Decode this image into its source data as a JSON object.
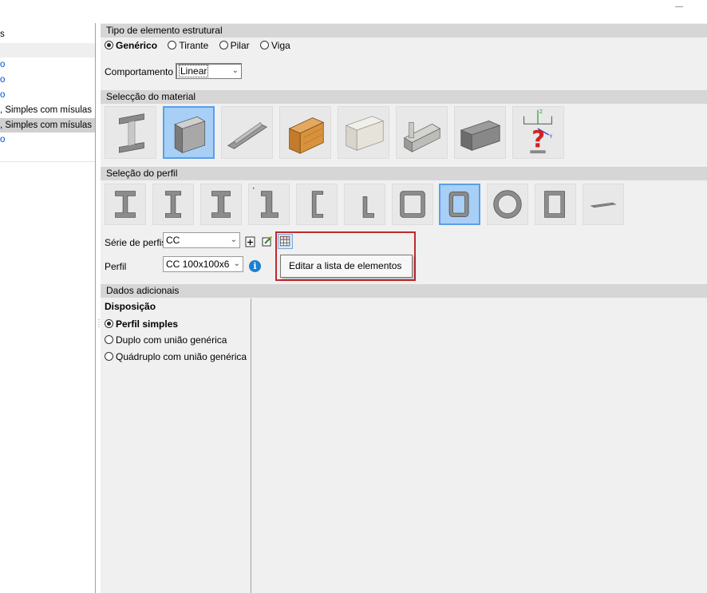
{
  "left_panel": {
    "rows": [
      {
        "label": "s"
      },
      {
        "label": ""
      },
      {
        "label": "o"
      },
      {
        "label": "o"
      },
      {
        "label": "o"
      },
      {
        "label": ", Simples com mísulas"
      },
      {
        "label": ", Simples com mísulas"
      },
      {
        "label": "o"
      },
      {
        "label": ""
      }
    ]
  },
  "structural": {
    "header": "Tipo de elemento estrutural",
    "options": [
      "Genérico",
      "Tirante",
      "Pilar",
      "Viga"
    ],
    "selected": "Genérico",
    "behavior_label": "Comportamento",
    "behavior_value": "Linear"
  },
  "material": {
    "header": "Selecção do material",
    "items": [
      "steel-hot-rolled-icon",
      "steel-cold-formed-icon",
      "aluminium-icon",
      "wood-icon",
      "generic-tube-icon",
      "aluminium-extruded-icon",
      "concrete-icon",
      "generic-unknown-icon"
    ],
    "selected_index": 1
  },
  "profile": {
    "header": "Seleção do perfil",
    "items": [
      "i-profile-icon",
      "i-profile-narrow-icon",
      "channel-profile-icon",
      "channel-lipped-icon",
      "c-profile-icon",
      "l-profile-icon",
      "rect-tube-icon",
      "rect-tube-narrow-icon",
      "circular-tube-icon",
      "rect-box-icon",
      "flat-plate-icon"
    ],
    "selected_index": 7,
    "series_label": "Série de perfis",
    "series_value": "CC",
    "profile_label": "Perfil",
    "profile_value": "CC 100x100x6",
    "tooltip": "Editar a lista de elementos"
  },
  "additional": {
    "header": "Dados adicionais",
    "disposition_label": "Disposição",
    "options": [
      "Perfil simples",
      "Duplo com união genérica",
      "Quádruplo com união genérica"
    ],
    "selected": "Perfil simples"
  }
}
